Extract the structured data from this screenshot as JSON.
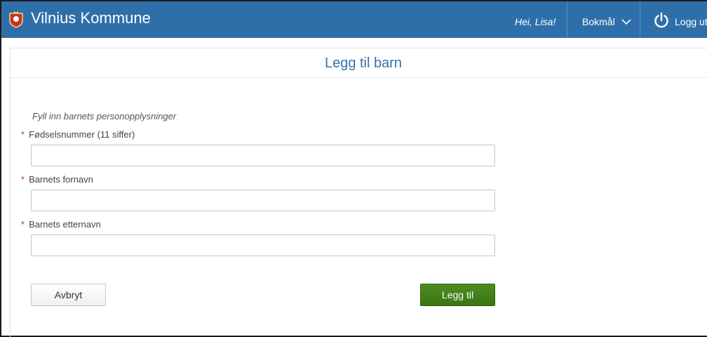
{
  "header": {
    "app_title": "Vilnius Kommune",
    "greeting": "Hei, Lisa!",
    "language": "Bokmål",
    "logout": "Logg ut"
  },
  "page": {
    "title": "Legg til barn",
    "instructions": "Fyll inn barnets personopplysninger"
  },
  "form": {
    "required_marker": "*",
    "fields": [
      {
        "label": "Fødselsnummer (11 siffer)",
        "value": ""
      },
      {
        "label": "Barnets fornavn",
        "value": ""
      },
      {
        "label": "Barnets etternavn",
        "value": ""
      }
    ],
    "cancel_label": "Avbryt",
    "submit_label": "Legg til"
  },
  "colors": {
    "header_bg": "#2f6fa9",
    "title_blue": "#3573a8",
    "submit_green": "#447f1a",
    "required_red": "#c0392b"
  },
  "icons": [
    "crest-logo-icon",
    "chevron-down-icon",
    "power-icon"
  ]
}
